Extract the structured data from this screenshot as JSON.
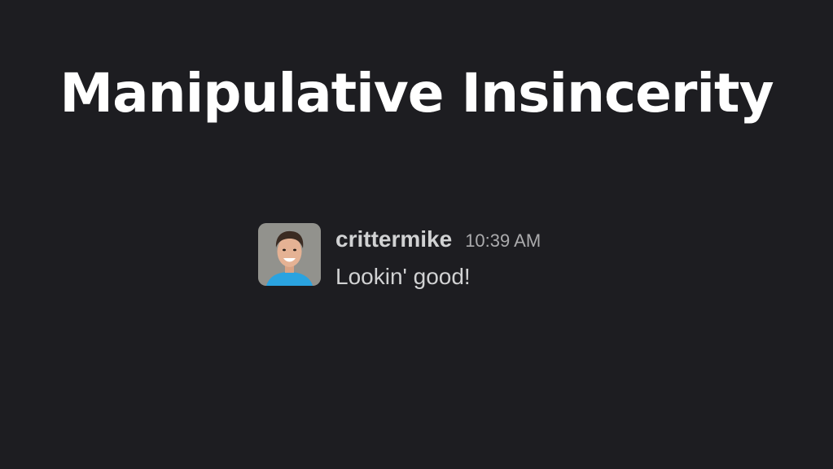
{
  "slide": {
    "title": "Manipulative Insincerity"
  },
  "message": {
    "username": "crittermike",
    "timestamp": "10:39 AM",
    "text": "Lookin' good!",
    "avatar_icon": "user-photo-avatar"
  },
  "colors": {
    "background": "#1d1d21",
    "title": "#ffffff",
    "username": "#d1d2d3",
    "timestamp": "#ababad",
    "message_text": "#d1d2d3"
  }
}
